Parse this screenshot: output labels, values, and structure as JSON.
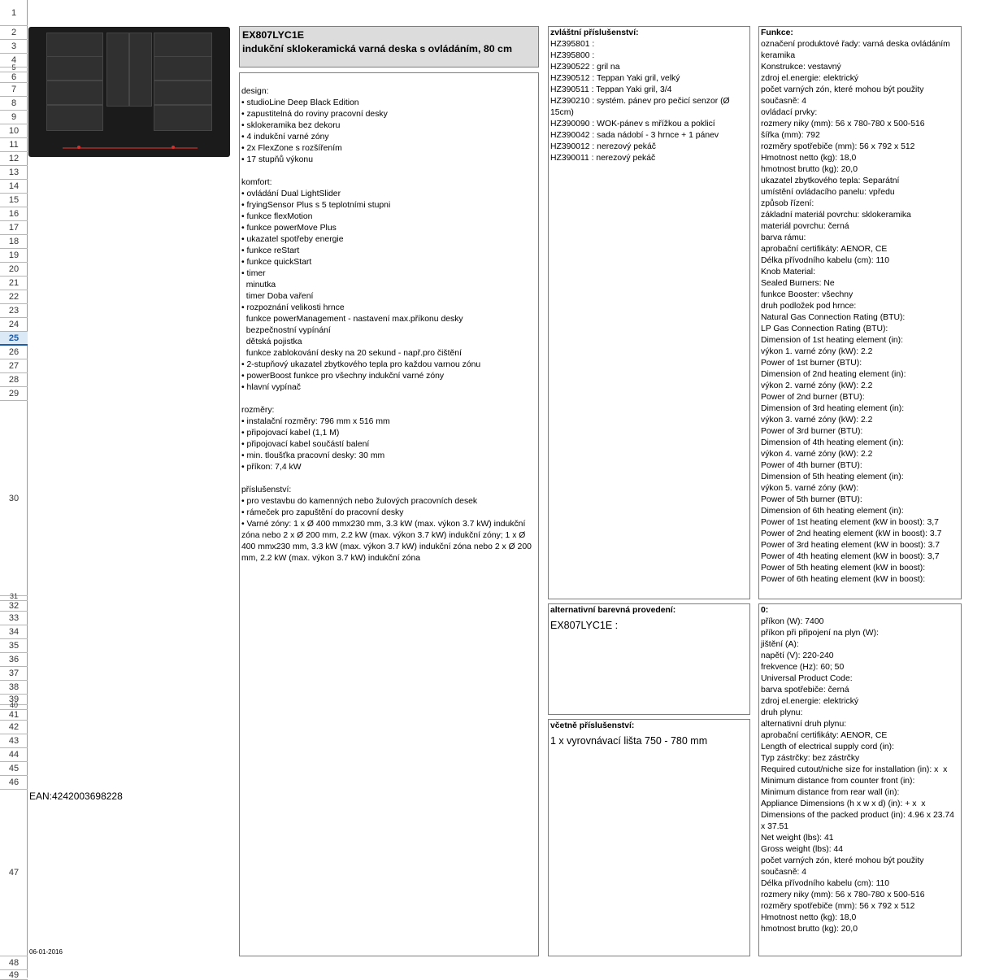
{
  "rows": [
    {
      "label": "1",
      "h": 32
    },
    {
      "label": "2",
      "h": 17
    },
    {
      "label": "3",
      "h": 17
    },
    {
      "label": "4",
      "h": 17
    },
    {
      "label": "5",
      "h": 6
    },
    {
      "label": "6",
      "h": 13
    },
    {
      "label": "7",
      "h": 17
    },
    {
      "label": "8",
      "h": 17
    },
    {
      "label": "9",
      "h": 17
    },
    {
      "label": "10",
      "h": 17
    },
    {
      "label": "11",
      "h": 17
    },
    {
      "label": "12",
      "h": 17
    },
    {
      "label": "13",
      "h": 17
    },
    {
      "label": "14",
      "h": 17
    },
    {
      "label": "15",
      "h": 17
    },
    {
      "label": "16",
      "h": 17
    },
    {
      "label": "17",
      "h": 17
    },
    {
      "label": "18",
      "h": 17
    },
    {
      "label": "19",
      "h": 17
    },
    {
      "label": "20",
      "h": 17
    },
    {
      "label": "21",
      "h": 17
    },
    {
      "label": "22",
      "h": 17
    },
    {
      "label": "23",
      "h": 17
    },
    {
      "label": "24",
      "h": 17
    },
    {
      "label": "25",
      "h": 17,
      "selected": true
    },
    {
      "label": "26",
      "h": 17
    },
    {
      "label": "27",
      "h": 17
    },
    {
      "label": "28",
      "h": 17
    },
    {
      "label": "29",
      "h": 17
    },
    {
      "label": "30",
      "h": 240
    },
    {
      "label": "31",
      "h": 6
    },
    {
      "label": "32",
      "h": 13
    },
    {
      "label": "33",
      "h": 17
    },
    {
      "label": "34",
      "h": 17
    },
    {
      "label": "35",
      "h": 17
    },
    {
      "label": "36",
      "h": 17
    },
    {
      "label": "37",
      "h": 17
    },
    {
      "label": "38",
      "h": 17
    },
    {
      "label": "39",
      "h": 13
    },
    {
      "label": "40",
      "h": 6
    },
    {
      "label": "41",
      "h": 13
    },
    {
      "label": "42",
      "h": 17
    },
    {
      "label": "43",
      "h": 17
    },
    {
      "label": "44",
      "h": 17
    },
    {
      "label": "45",
      "h": 17
    },
    {
      "label": "46",
      "h": 17
    },
    {
      "label": "47",
      "h": 205
    },
    {
      "label": "48",
      "h": 17
    },
    {
      "label": "49",
      "h": 12
    }
  ],
  "product": {
    "code": "EX807LYC1E",
    "name": "indukční sklokeramická varná deska s ovládáním, 80 cm"
  },
  "ean": "EAN:4242003698228",
  "date": "06-01-2016",
  "description": [
    "design:",
    "• studioLine Deep Black Edition",
    "• zapustitelná do roviny pracovní desky",
    "• sklokeramika bez dekoru",
    "• 4 indukční varné zóny",
    "• 2x FlexZone s rozšířením",
    "• 17 stupňů výkonu",
    "",
    "komfort:",
    "• ovládání Dual LightSlider",
    "• fryingSensor Plus s 5 teplotními stupni",
    "• funkce flexMotion",
    "• funkce powerMove Plus",
    "• ukazatel spotřeby energie",
    "• funkce reStart",
    "• funkce quickStart",
    "• timer",
    "  minutka",
    "  timer Doba vaření",
    "• rozpoznání velikosti hrnce",
    "  funkce powerManagement - nastavení max.příkonu desky",
    "  bezpečnostní vypínání",
    "  dětská pojistka",
    "  funkce zablokování desky na 20 sekund - např.pro čištění",
    "• 2-stupňový ukazatel zbytkového tepla pro každou varnou zónu",
    "• powerBoost funkce pro všechny indukční varné zóny",
    "• hlavní vypínač",
    "",
    "rozměry:",
    "• instalační rozměry: 796 mm x 516 mm",
    "• připojovací kabel (1,1 M)",
    "• připojovací kabel součástí balení",
    "• min. tloušťka pracovní desky: 30 mm",
    "• příkon: 7,4 kW",
    "",
    "příslušenství:",
    "• pro vestavbu do kamenných nebo žulových pracovních desek",
    "• rámeček pro zapuštění do pracovní desky",
    "• Varné zóny: 1 x Ø 400 mmx230 mm, 3.3 kW (max. výkon 3.7 kW) indukční zóna nebo 2 x Ø 200 mm, 2.2 kW (max. výkon 3.7 kW) indukční zóny; 1 x Ø 400 mmx230 mm, 3.3 kW (max. výkon 3.7 kW) indukční zóna nebo 2 x Ø 200 mm, 2.2 kW (max. výkon 3.7 kW) indukční zóna"
  ],
  "accessories": {
    "heading": "zvláštní příslušenství:",
    "items": [
      "HZ395801 :",
      "HZ395800 :",
      "HZ390522 : gril na",
      "HZ390512 : Teppan Yaki gril, velký",
      "HZ390511 : Teppan Yaki gril, 3/4",
      "HZ390210 : systém. pánev pro pečicí senzor (Ø 15cm)",
      "HZ390090 : WOK-pánev s mřížkou a poklicí",
      "HZ390042 : sada nádobí - 3 hrnce + 1 pánev",
      "HZ390012 : nerezový pekáč",
      "HZ390011 : nerezový pekáč"
    ]
  },
  "alternative": {
    "heading": "alternativní barevná provedení:",
    "value": "EX807LYC1E :"
  },
  "included": {
    "heading": "včetně příslušenství:",
    "value": "1 x vyrovnávací lišta 750 - 780 mm"
  },
  "functions": {
    "heading": "Funkce:",
    "items": [
      "označení produktové řady: varná deska ovládáním keramika",
      "Konstrukce: vestavný",
      "zdroj el.energie: elektrický",
      "počet varných zón, které mohou být použity současně: 4",
      "ovládací prvky:",
      "rozmery niky (mm): 56 x 780-780 x 500-516",
      "šířka (mm): 792",
      "rozměry spotřebiče (mm): 56 x 792 x 512",
      "Hmotnost netto (kg): 18,0",
      "hmotnost brutto (kg): 20,0",
      "ukazatel zbytkového tepla: Separátní",
      "umístění ovládacího panelu: vpředu",
      "způsob řízení:",
      "základní materiál povrchu: sklokeramika",
      "materiál povrchu: černá",
      "barva rámu:",
      "aprobační certifikáty: AENOR, CE",
      "Délka přívodního kabelu (cm): 110",
      "Knob Material:",
      "Sealed Burners: Ne",
      "funkce Booster: všechny",
      "druh podložek pod hrnce:",
      "Natural Gas Connection Rating (BTU):",
      "LP Gas Connection Rating (BTU):",
      "Dimension of 1st heating element (in):",
      "výkon 1. varné zóny (kW): 2.2",
      "Power of 1st burner (BTU):",
      "Dimension of 2nd heating element (in):",
      "výkon 2. varné zóny (kW): 2.2",
      "Power of 2nd burner (BTU):",
      "Dimension of 3rd heating element (in):",
      "výkon 3. varné zóny (kW): 2.2",
      "Power of 3rd burner (BTU):",
      "Dimension of 4th heating element (in):",
      "výkon 4. varné zóny (kW): 2.2",
      "Power of 4th burner (BTU):",
      "Dimension of 5th heating element (in):",
      "výkon 5. varné zóny (kW):",
      "Power of 5th burner (BTU):",
      "Dimension of 6th heating element (in):",
      "Power of 1st heating element (kW in boost): 3,7",
      "Power of 2nd heating element (kW in boost): 3.7",
      "Power of 3rd heating element (kW in boost): 3.7",
      "Power of 4th heating element (kW in boost): 3,7",
      "Power of 5th heating element (kW in boost):",
      "Power of 6th heating element (kW in boost):"
    ]
  },
  "technical": {
    "heading": "0:",
    "items": [
      "příkon (W): 7400",
      "příkon při připojení na plyn (W):",
      "jištění (A):",
      "napětí (V): 220-240",
      "frekvence (Hz): 60; 50",
      "Universal Product Code:",
      "barva spotřebiče: černá",
      "zdroj el.energie: elektrický",
      "druh plynu:",
      "alternativní druh plynu:",
      "aprobační certifikáty: AENOR, CE",
      "Length of electrical supply cord (in):",
      "Typ zástrčky: bez zástrčky",
      "Required cutout/niche size for installation (in): x  x",
      "Minimum distance from counter front (in):",
      "Minimum distance from rear wall (in):",
      "Appliance Dimensions (h x w x d) (in): + x  x",
      "Dimensions of the packed product (in): 4.96 x 23.74 x 37.51",
      "Net weight (lbs): 41",
      "Gross weight (lbs): 44",
      "počet varných zón, které mohou být použity současně: 4",
      "Délka přívodního kabelu (cm): 110",
      "rozmery niky (mm): 56 x 780-780 x 500-516",
      "rozměry spotřebiče (mm): 56 x 792 x 512",
      "Hmotnost netto (kg): 18,0",
      "hmotnost brutto (kg): 20,0"
    ]
  },
  "image": {
    "icon": "cooktop-product-photo",
    "color": "#1b1b1b",
    "accent": "#d0312d"
  }
}
